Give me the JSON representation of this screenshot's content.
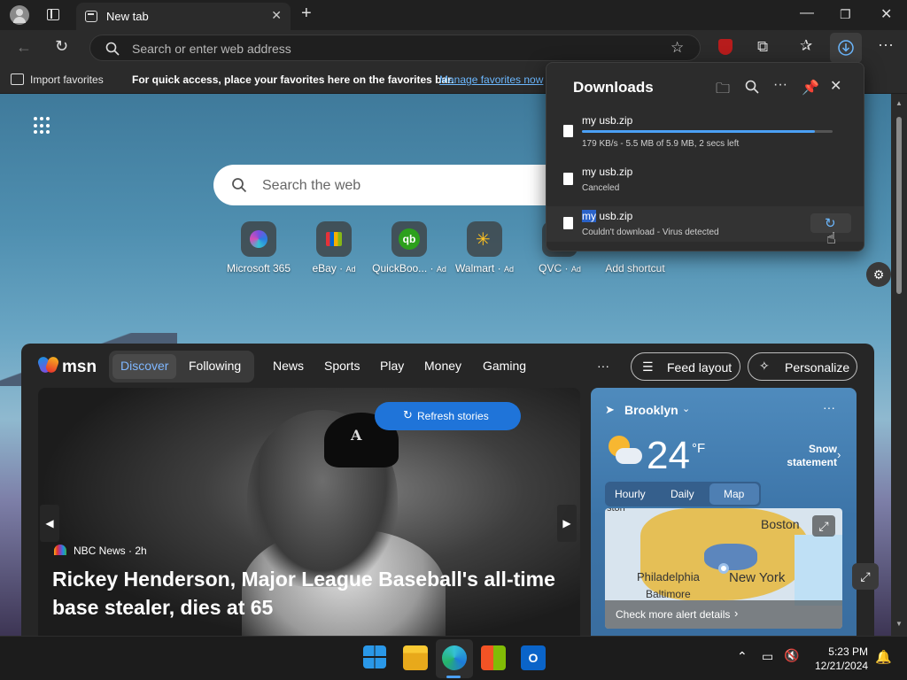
{
  "browser": {
    "tab_title": "New tab",
    "address_placeholder": "Search or enter web address",
    "favorites_bar": {
      "import_label": "Import favorites",
      "message": "For quick access, place your favorites here on the favorites bar.",
      "manage_link": "Manage favorites now"
    }
  },
  "downloads": {
    "title": "Downloads",
    "items": [
      {
        "name": "my usb.zip",
        "status": "179 KB/s - 5.5 MB of 5.9 MB, 2 secs left",
        "progress": 0.93
      },
      {
        "name": "my usb.zip",
        "status": "Canceled"
      },
      {
        "name_highlight": "my",
        "name_rest": " usb.zip",
        "status": "Couldn't download - Virus detected"
      }
    ]
  },
  "new_tab": {
    "search_placeholder": "Search the web",
    "quick_links": [
      {
        "label": "Microsoft 365",
        "ad": ""
      },
      {
        "label": "eBay",
        "ad": "Ad"
      },
      {
        "label": "QuickBoo...",
        "ad": "Ad"
      },
      {
        "label": "Walmart",
        "ad": "Ad"
      },
      {
        "label": "QVC",
        "ad": "Ad"
      },
      {
        "label": "Add shortcut",
        "ad": ""
      }
    ]
  },
  "feed": {
    "brand": "msn",
    "nav": [
      "Discover",
      "Following",
      "News",
      "Sports",
      "Play",
      "Money",
      "Gaming"
    ],
    "more": "···",
    "feed_layout": "Feed layout",
    "personalize": "Personalize",
    "refresh": "Refresh stories",
    "story": {
      "source": "NBC News",
      "age": "· 2h",
      "headline": "Rickey Henderson, Major League Baseball's all-time base stealer, dies at 65"
    },
    "weather": {
      "city": "Brooklyn",
      "temp": "24",
      "unit": "°F",
      "alert": "Snow statement",
      "tabs": [
        "Hourly",
        "Daily",
        "Map"
      ],
      "map_labels": [
        "ston",
        "Boston",
        "Philadelphia",
        "Baltimore",
        "New York"
      ],
      "cta": "Check more alert details"
    }
  },
  "taskbar": {
    "time": "5:23 PM",
    "date": "12/21/2024"
  },
  "colors": {
    "accent": "#1f74d9",
    "progress": "#4ba0f5",
    "link": "#6cb8ff"
  }
}
